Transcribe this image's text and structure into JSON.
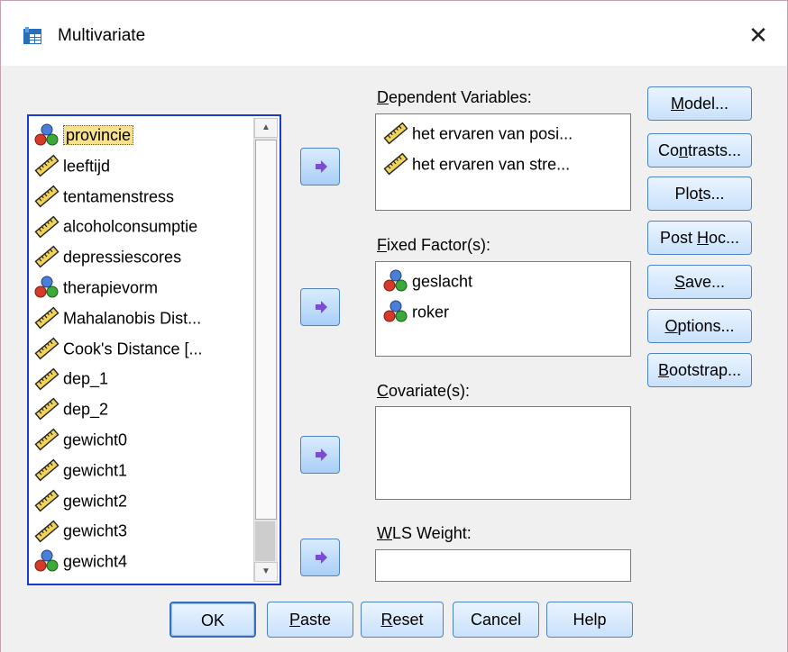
{
  "window": {
    "title": "Multivariate",
    "close_glyph": "✕"
  },
  "variables": [
    {
      "label": "provincie",
      "icon": "nominal-icon",
      "selected": true
    },
    {
      "label": "leeftijd",
      "icon": "scale-icon"
    },
    {
      "label": "tentamenstress",
      "icon": "scale-icon"
    },
    {
      "label": "alcoholconsumptie",
      "icon": "scale-icon"
    },
    {
      "label": "depressiescores",
      "icon": "scale-icon"
    },
    {
      "label": "therapievorm",
      "icon": "nominal-icon"
    },
    {
      "label": "Mahalanobis Dist...",
      "icon": "scale-icon"
    },
    {
      "label": "Cook's Distance [...",
      "icon": "scale-icon"
    },
    {
      "label": "dep_1",
      "icon": "scale-icon"
    },
    {
      "label": "dep_2",
      "icon": "scale-icon"
    },
    {
      "label": "gewicht0",
      "icon": "scale-icon"
    },
    {
      "label": "gewicht1",
      "icon": "scale-icon"
    },
    {
      "label": "gewicht2",
      "icon": "scale-icon"
    },
    {
      "label": "gewicht3",
      "icon": "scale-icon"
    },
    {
      "label": "gewicht4",
      "icon": "nominal-icon"
    }
  ],
  "sections": {
    "dependent": {
      "label_u": "D",
      "label_rest": "ependent Variables:",
      "items": [
        {
          "label": "het ervaren van posi...",
          "icon": "scale-icon"
        },
        {
          "label": "het ervaren van stre...",
          "icon": "scale-icon"
        }
      ]
    },
    "fixed": {
      "label_u": "F",
      "label_rest": "ixed Factor(s):",
      "items": [
        {
          "label": "geslacht",
          "icon": "nominal-icon"
        },
        {
          "label": "roker",
          "icon": "nominal-icon"
        }
      ]
    },
    "covariates": {
      "label_u": "C",
      "label_rest": "ovariate(s):",
      "items": []
    },
    "wls": {
      "label_u": "W",
      "label_rest": "LS Weight:",
      "value": ""
    }
  },
  "side_buttons": [
    {
      "name": "model-button",
      "pre": "",
      "u": "M",
      "post": "odel..."
    },
    {
      "name": "contrasts-button",
      "pre": "Co",
      "u": "n",
      "post": "trasts..."
    },
    {
      "name": "plots-button",
      "pre": "Plo",
      "u": "t",
      "post": "s..."
    },
    {
      "name": "post-hoc-button",
      "pre": "Post ",
      "u": "H",
      "post": "oc..."
    },
    {
      "name": "save-button",
      "pre": "",
      "u": "S",
      "post": "ave..."
    },
    {
      "name": "options-button",
      "pre": "",
      "u": "O",
      "post": "ptions..."
    },
    {
      "name": "bootstrap-button",
      "pre": "",
      "u": "B",
      "post": "ootstrap..."
    }
  ],
  "bottom_buttons": [
    {
      "name": "ok-button",
      "pre": "OK",
      "u": "",
      "post": ""
    },
    {
      "name": "paste-button",
      "pre": "",
      "u": "P",
      "post": "aste"
    },
    {
      "name": "reset-button",
      "pre": "",
      "u": "R",
      "post": "eset"
    },
    {
      "name": "cancel-button",
      "pre": "Cancel",
      "u": "",
      "post": ""
    },
    {
      "name": "help-button",
      "pre": "Help",
      "u": "",
      "post": ""
    }
  ],
  "colors": {
    "accent_border": "#4f83c4",
    "selection": "#f8e18c",
    "list_border": "#1a3bc9"
  }
}
